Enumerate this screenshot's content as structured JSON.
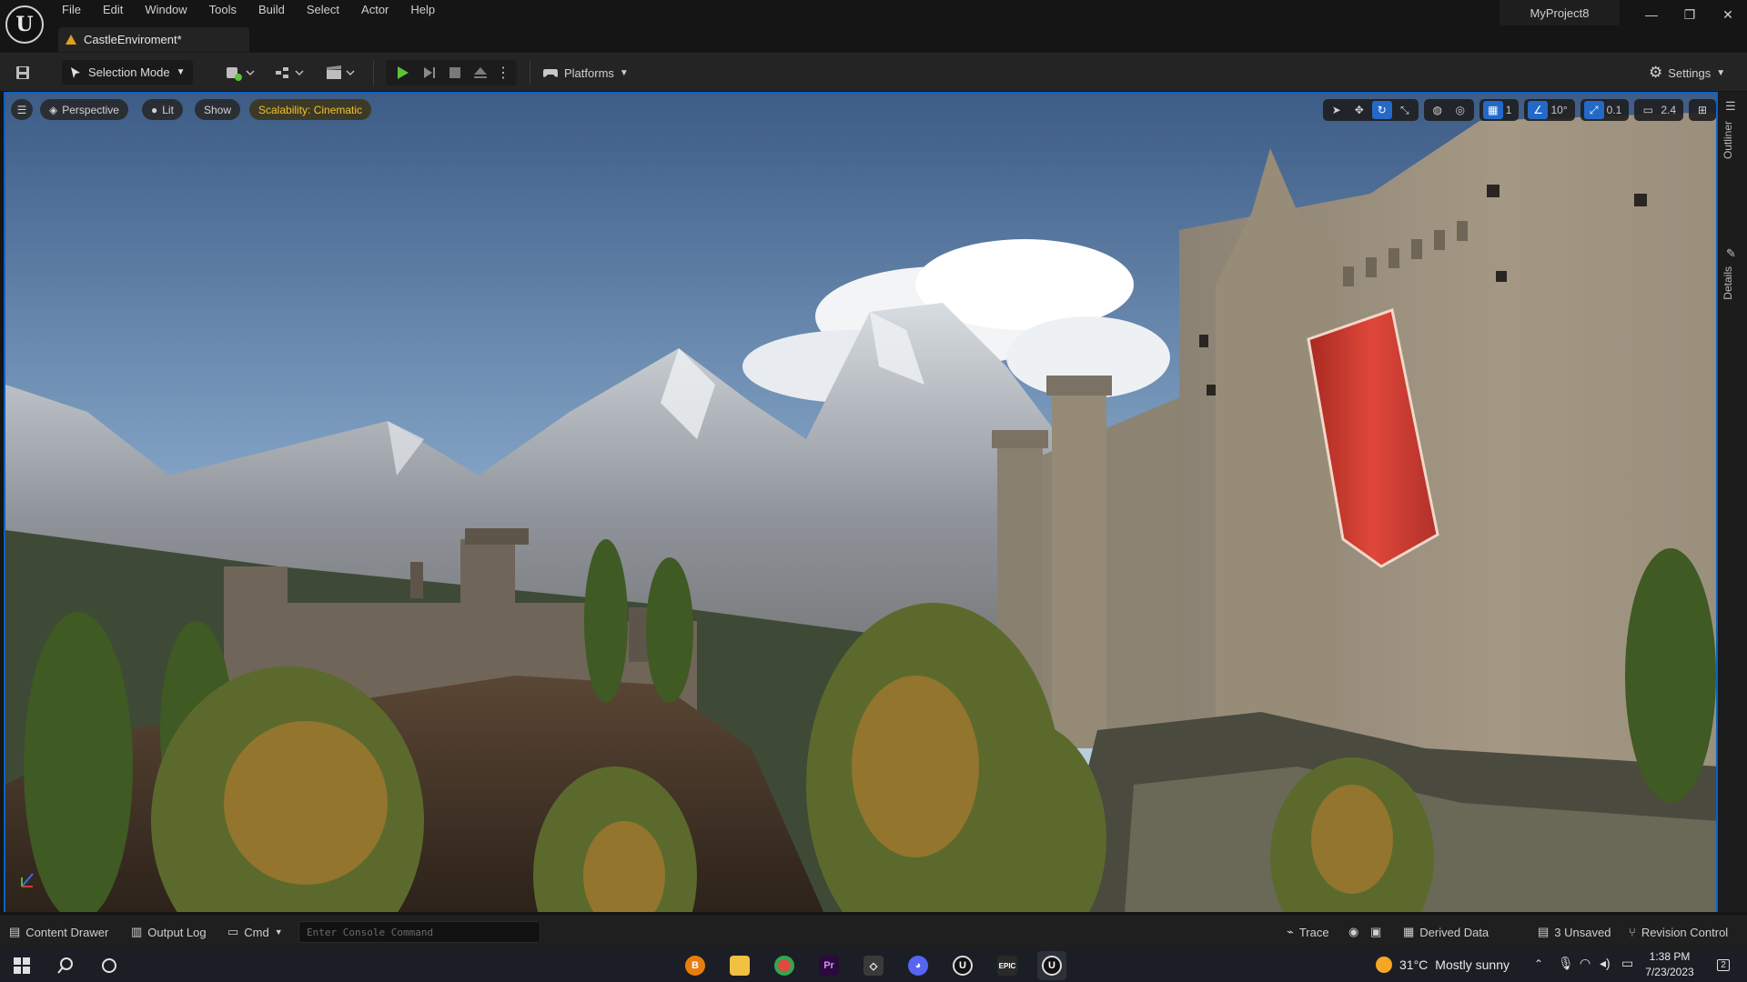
{
  "menu": {
    "items": [
      "File",
      "Edit",
      "Window",
      "Tools",
      "Build",
      "Select",
      "Actor",
      "Help"
    ]
  },
  "level_tab": {
    "label": "CastleEnviroment*"
  },
  "project_name": "MyProject8",
  "window_controls": {
    "minimize": "—",
    "restore": "❐",
    "close": "✕"
  },
  "toolbar": {
    "selection_mode": "Selection Mode",
    "platforms": "Platforms",
    "settings": "Settings"
  },
  "viewport": {
    "perspective": "Perspective",
    "lit": "Lit",
    "show": "Show",
    "scalability": "Scalability: Cinematic",
    "camera_speed_grid": "1",
    "rotation_snap": "10°",
    "scale_snap": "0.1",
    "camera_speed": "2.4"
  },
  "side_panel": {
    "outliner": "Outliner",
    "details": "Details"
  },
  "statusbar": {
    "content_drawer": "Content Drawer",
    "output_log": "Output Log",
    "cmd": "Cmd",
    "console_placeholder": "Enter Console Command",
    "trace": "Trace",
    "derived_data": "Derived Data",
    "unsaved": "3 Unsaved",
    "revision_control": "Revision Control"
  },
  "taskbar": {
    "apps": [
      "blender",
      "file-explorer",
      "chrome",
      "premiere-pro",
      "unity",
      "discord",
      "unreal-engine",
      "epic-games",
      "unreal-editor"
    ],
    "weather_temp": "31°C",
    "weather_desc": "Mostly sunny",
    "time": "1:38 PM",
    "date": "7/23/2023",
    "notification_count": "2"
  },
  "colors": {
    "accent_blue": "#2469c8",
    "scalability_yellow": "#f2c230",
    "play_green": "#5cc238",
    "banner_red": "#c8342a"
  }
}
